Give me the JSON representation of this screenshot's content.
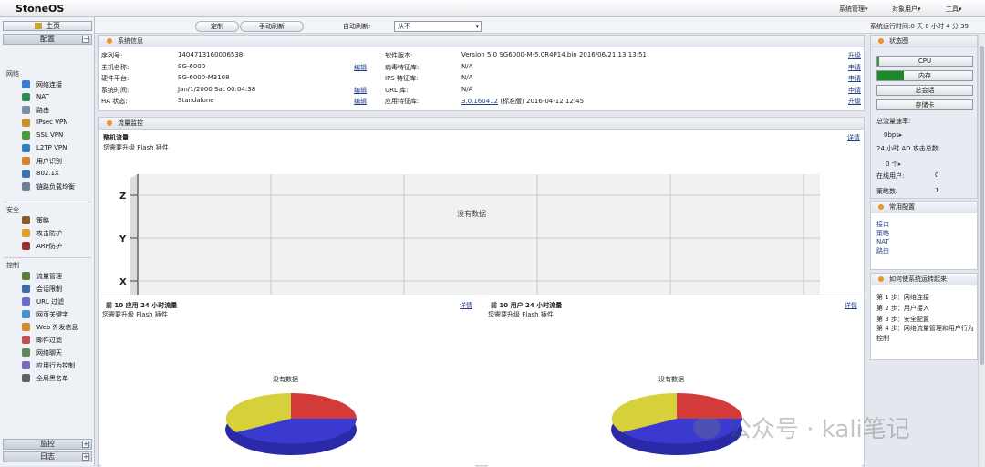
{
  "app": {
    "title": "StoneOS"
  },
  "top_menu": [
    "系统管理▾",
    "对象用户▾",
    "工具▾"
  ],
  "runtime": "系统运行时间:0 天 0 小时 4 分 39",
  "toolbar": {
    "customize_label": "定制",
    "manual_refresh_label": "手动刷新",
    "auto_refresh_label": "自动刷新:",
    "auto_refresh_value": "从不"
  },
  "sidebar": {
    "home_label": "主页",
    "config_label": "配置",
    "sections": [
      {
        "title": "网络",
        "items": [
          "网络连接",
          "NAT",
          "路由",
          "IPsec VPN",
          "SSL VPN",
          "L2TP VPN",
          "用户识别",
          "802.1X",
          "链路负载均衡"
        ]
      },
      {
        "title": "安全",
        "items": [
          "策略",
          "攻击防护",
          "ARP防护"
        ]
      },
      {
        "title": "控制",
        "items": [
          "流量管理",
          "会话限制",
          "URL 过滤",
          "网页关键字",
          "Web 外发信息",
          "邮件过滤",
          "网络聊天",
          "应用行为控制",
          "全局黑名单"
        ]
      }
    ],
    "monitor_label": "监控",
    "log_label": "日志",
    "colors": [
      "#3a7bd5",
      "#2e8b57",
      "#7a8fa6",
      "#c7902a",
      "#4a9a3a",
      "#2f7fbf",
      "#d9822b",
      "#3f6fb5",
      "#6d7f93",
      "#8a5a2b",
      "#e0a020",
      "#9b3030",
      "#5a7d3a",
      "#3a6ea5",
      "#6a6ad0",
      "#4a8fd0",
      "#d08a2a",
      "#c05050",
      "#5a8a5a",
      "#7a6abf",
      "#606060"
    ]
  },
  "sysinfo": {
    "title": "系统信息",
    "left": [
      {
        "label": "序列号:",
        "value": "1404713160006538",
        "action": ""
      },
      {
        "label": "主机名称:",
        "value": "SG-6000",
        "action": "编辑"
      },
      {
        "label": "硬件平台:",
        "value": "SG-6000-M3108",
        "action": ""
      },
      {
        "label": "系统时间:",
        "value": "Jan/1/2000  Sat  00:04:38",
        "action": "编辑"
      },
      {
        "label": "HA 状态:",
        "value": "Standalone",
        "action": "编辑"
      }
    ],
    "right": [
      {
        "label": "软件版本:",
        "value": "Version 5.0 SG6000-M-5.0R4P14.bin 2016/06/21 13:13:51",
        "link": "",
        "action": "升级"
      },
      {
        "label": "病毒特征库:",
        "value": "N/A",
        "link": "",
        "action": "申请"
      },
      {
        "label": "IPS 特征库:",
        "value": "N/A",
        "link": "",
        "action": "申请"
      },
      {
        "label": "URL 库:",
        "value": "N/A",
        "link": "",
        "action": "申请"
      },
      {
        "label": "应用特征库:",
        "value": " (标准版) 2016-04-12 12:45",
        "link": "3.0.160412",
        "action": "升级"
      }
    ]
  },
  "traffic": {
    "title": "流量监控",
    "overall": {
      "title": "整机流量",
      "detail": "详情",
      "flash_notice": "您需要升级 Flash 插件",
      "no_data": "没有数据"
    },
    "top_apps": {
      "title": "前 10 应用 24 小时流量",
      "detail": "详情",
      "flash_notice": "您需要升级 Flash 插件",
      "no_data": "没有数据"
    },
    "top_users": {
      "title": "前 10 用户 24 小时流量",
      "detail": "详情",
      "flash_notice": "您需要升级 Flash 插件",
      "no_data": "没有数据"
    }
  },
  "chart_data": {
    "type": "line",
    "x": [],
    "series": [],
    "ytick_labels": [
      "Z",
      "Y",
      "X"
    ],
    "grid": true
  },
  "status": {
    "title": "状态图",
    "buttons": [
      "CPU",
      "内存",
      "总会话",
      "存储卡"
    ],
    "bar_levels": [
      0.02,
      0.28
    ],
    "rate_label": "总流量速率:",
    "rate_value": "0bps",
    "ad_label": "24 小时 AD 攻击总数:",
    "ad_value": "0 个",
    "online_label": "在线用户:",
    "online_value": "0",
    "policy_label": "策略数:",
    "policy_value": "1"
  },
  "common_config": {
    "title": "常用配置",
    "links": [
      "接口",
      "策略",
      "NAT",
      "路由"
    ]
  },
  "howto": {
    "title": "如何使系统运转起来",
    "steps": [
      "第 1 步：网络连接",
      "第 2 步：用户接入",
      "第 3 步：安全配置",
      "第 4 步：网络流量管理和用户行为控制"
    ]
  },
  "watermark": "公众号 · kali笔记"
}
